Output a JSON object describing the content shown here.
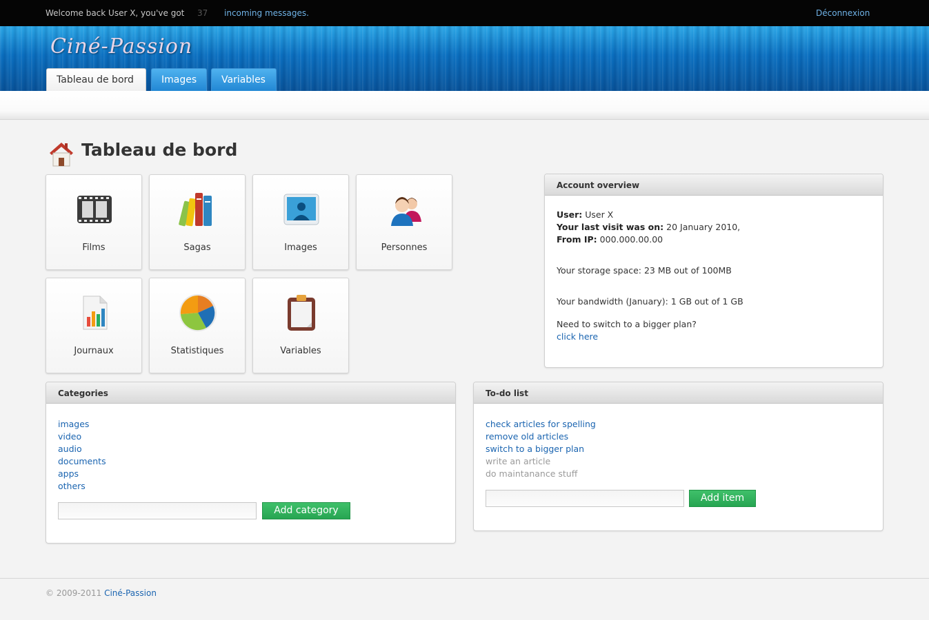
{
  "topbar": {
    "welcome": "Welcome back User X, you've got",
    "message_count": "37",
    "messages_link": "incoming messages.",
    "logout": "Déconnexion"
  },
  "header": {
    "logo": "Ciné-Passion",
    "tabs": [
      {
        "label": "Tableau de bord",
        "active": true
      },
      {
        "label": "Images",
        "active": false
      },
      {
        "label": "Variables",
        "active": false
      }
    ]
  },
  "page": {
    "title": "Tableau de bord",
    "title_icon": "home-icon"
  },
  "tiles": [
    {
      "label": "Films",
      "icon": "film-icon"
    },
    {
      "label": "Sagas",
      "icon": "books-icon"
    },
    {
      "label": "Images",
      "icon": "image-icon"
    },
    {
      "label": "Personnes",
      "icon": "people-icon"
    },
    {
      "label": "Journaux",
      "icon": "log-chart-icon"
    },
    {
      "label": "Statistiques",
      "icon": "pie-chart-icon"
    },
    {
      "label": "Variables",
      "icon": "clipboard-icon"
    }
  ],
  "account": {
    "title": "Account overview",
    "user_label": "User:",
    "user_value": "User X",
    "last_visit_label": "Your last visit was on:",
    "last_visit_value": "20 January 2010,",
    "ip_label": "From IP:",
    "ip_value": "000.000.00.00",
    "storage": "Your storage space: 23 MB out of 100MB",
    "bandwidth": "Your bandwidth (January): 1 GB out of 1 GB",
    "upgrade_question": "Need to switch to a bigger plan?",
    "upgrade_link": "click here"
  },
  "categories": {
    "title": "Categories",
    "items": [
      "images",
      "video",
      "audio",
      "documents",
      "apps",
      "others"
    ],
    "input_value": "",
    "button": "Add category"
  },
  "todo": {
    "title": "To-do list",
    "items": [
      {
        "label": "check articles for spelling",
        "done": false
      },
      {
        "label": "remove old articles",
        "done": false
      },
      {
        "label": "switch to a bigger plan",
        "done": false
      },
      {
        "label": "write an article",
        "done": true
      },
      {
        "label": "do maintanance stuff",
        "done": true
      }
    ],
    "input_value": "",
    "button": "Add item"
  },
  "footer": {
    "copyright": "© 2009-2011",
    "brand_link": "Ciné-Passion"
  },
  "colors": {
    "link": "#1a64b0",
    "header_blue": "#0a6fc0",
    "button_green": "#2fb05c",
    "done_gray": "#9a9a9a"
  }
}
